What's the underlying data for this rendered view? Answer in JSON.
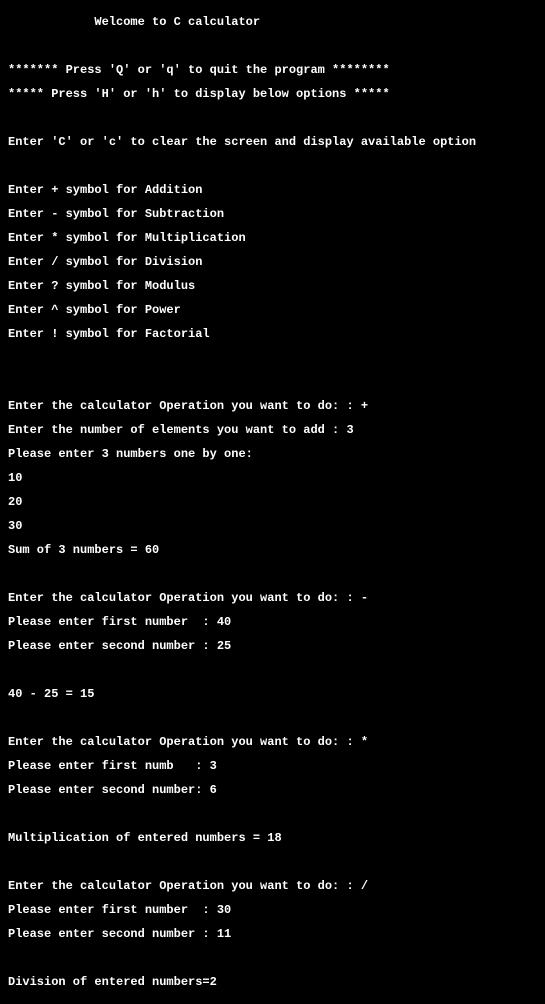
{
  "lines": [
    "            Welcome to C calculator",
    "",
    "******* Press 'Q' or 'q' to quit the program ********",
    "***** Press 'H' or 'h' to display below options *****",
    "",
    "Enter 'C' or 'c' to clear the screen and display available option",
    "",
    "Enter + symbol for Addition",
    "Enter - symbol for Subtraction",
    "Enter * symbol for Multiplication",
    "Enter / symbol for Division",
    "Enter ? symbol for Modulus",
    "Enter ^ symbol for Power",
    "Enter ! symbol for Factorial",
    "",
    "",
    "Enter the calculator Operation you want to do: : +",
    "Enter the number of elements you want to add : 3",
    "Please enter 3 numbers one by one:",
    "10",
    "20",
    "30",
    "Sum of 3 numbers = 60",
    "",
    "Enter the calculator Operation you want to do: : -",
    "Please enter first number  : 40",
    "Please enter second number : 25",
    "",
    "40 - 25 = 15",
    "",
    "Enter the calculator Operation you want to do: : *",
    "Please enter first numb   : 3",
    "Please enter second number: 6",
    "",
    "Multiplication of entered numbers = 18",
    "",
    "Enter the calculator Operation you want to do: : /",
    "Please enter first number  : 30",
    "Please enter second number : 11",
    "",
    "Division of entered numbers=2"
  ]
}
